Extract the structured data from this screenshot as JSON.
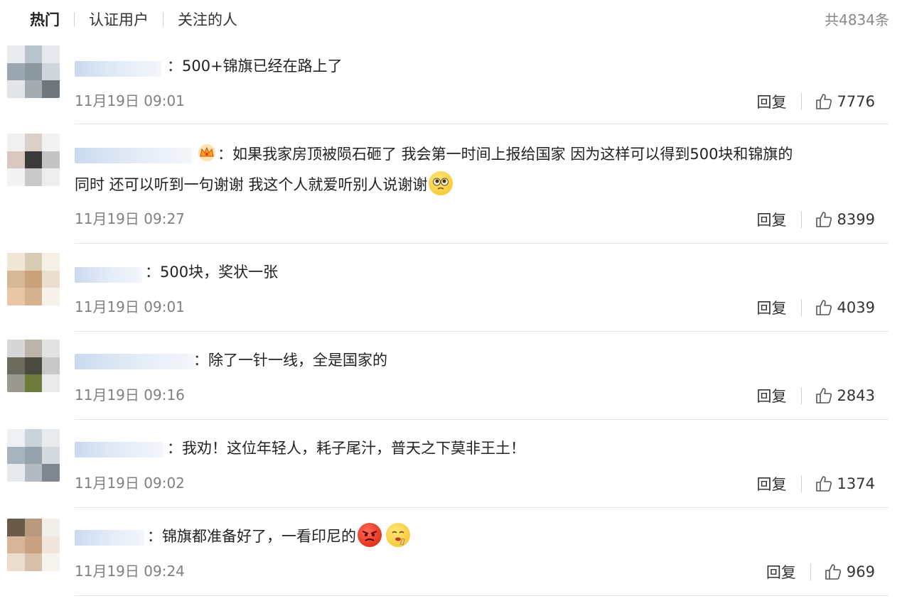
{
  "tabs": [
    {
      "label": "热门"
    },
    {
      "label": "认证用户"
    },
    {
      "label": "关注的人"
    }
  ],
  "total": "共4834条",
  "reply_label": "回复",
  "colon": "：",
  "comments": [
    {
      "text": "500+锦旗已经在路上了",
      "time": "11月19日 09:01",
      "likes": "7776"
    },
    {
      "text_line1": "如果我家房顶被陨石砸了 我会第一时间上报给国家 因为这样可以得到500块和锦旗的",
      "text_line2": "同时 还可以听到一句谢谢 我这个人就爱听别人说谢谢",
      "time": "11月19日 09:27",
      "likes": "8399"
    },
    {
      "text": "500块，奖状一张",
      "time": "11月19日 09:01",
      "likes": "4039"
    },
    {
      "text": "除了一针一线，全是国家的",
      "time": "11月19日 09:16",
      "likes": "2843"
    },
    {
      "text": "我劝！这位年轻人，耗子尾汁，普天之下莫非王土！",
      "time": "11月19日 09:02",
      "likes": "1374"
    },
    {
      "text": "锦旗都准备好了，一看印尼的",
      "time": "11月19日 09:24",
      "likes": "969"
    }
  ],
  "colors": {
    "link_blue": "#c9d9ee",
    "time_gray": "#808080",
    "divider": "#e5e5e5"
  }
}
